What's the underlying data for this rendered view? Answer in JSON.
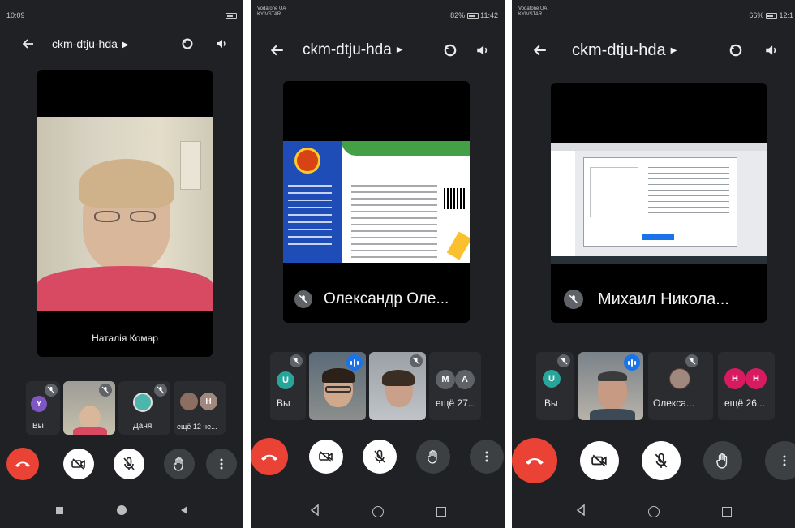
{
  "meeting": {
    "code": "ckm-dtju-hda"
  },
  "colors": {
    "background": "#202124",
    "end_call": "#ea4335",
    "accent_blue": "#1a73e8",
    "tile": "#2b2c2f"
  },
  "phones": [
    {
      "status": {
        "time": "10:09",
        "carrier": ""
      },
      "main_tile": {
        "name": "Наталія Комар"
      },
      "thumbnails": [
        {
          "label": "Вы",
          "avatar_letter": "Y"
        },
        {
          "label": ""
        },
        {
          "label": "Даня"
        },
        {
          "label": "ещё 12 че...",
          "avatar_letter": "H"
        }
      ]
    },
    {
      "status": {
        "carrier": "Vodafone UA KYIVSTAR",
        "battery": "82%",
        "time": "11:42"
      },
      "main_tile": {
        "name": "Олександр Оле..."
      },
      "thumbnails": [
        {
          "label": "Вы",
          "avatar_letter": "U"
        },
        {
          "label": ""
        },
        {
          "label": ""
        },
        {
          "label": "ещё 27...",
          "avatar_letters": [
            "M",
            "A"
          ]
        }
      ]
    },
    {
      "status": {
        "carrier": "Vodafone UA KYIVSTAR",
        "battery": "66%",
        "time": "12:1"
      },
      "main_tile": {
        "name": "Михаил Никола..."
      },
      "thumbnails": [
        {
          "label": "Вы",
          "avatar_letter": "U"
        },
        {
          "label": ""
        },
        {
          "label": "Олекса..."
        },
        {
          "label": "ещё 26...",
          "avatar_letters": [
            "H",
            "H"
          ]
        }
      ]
    }
  ]
}
